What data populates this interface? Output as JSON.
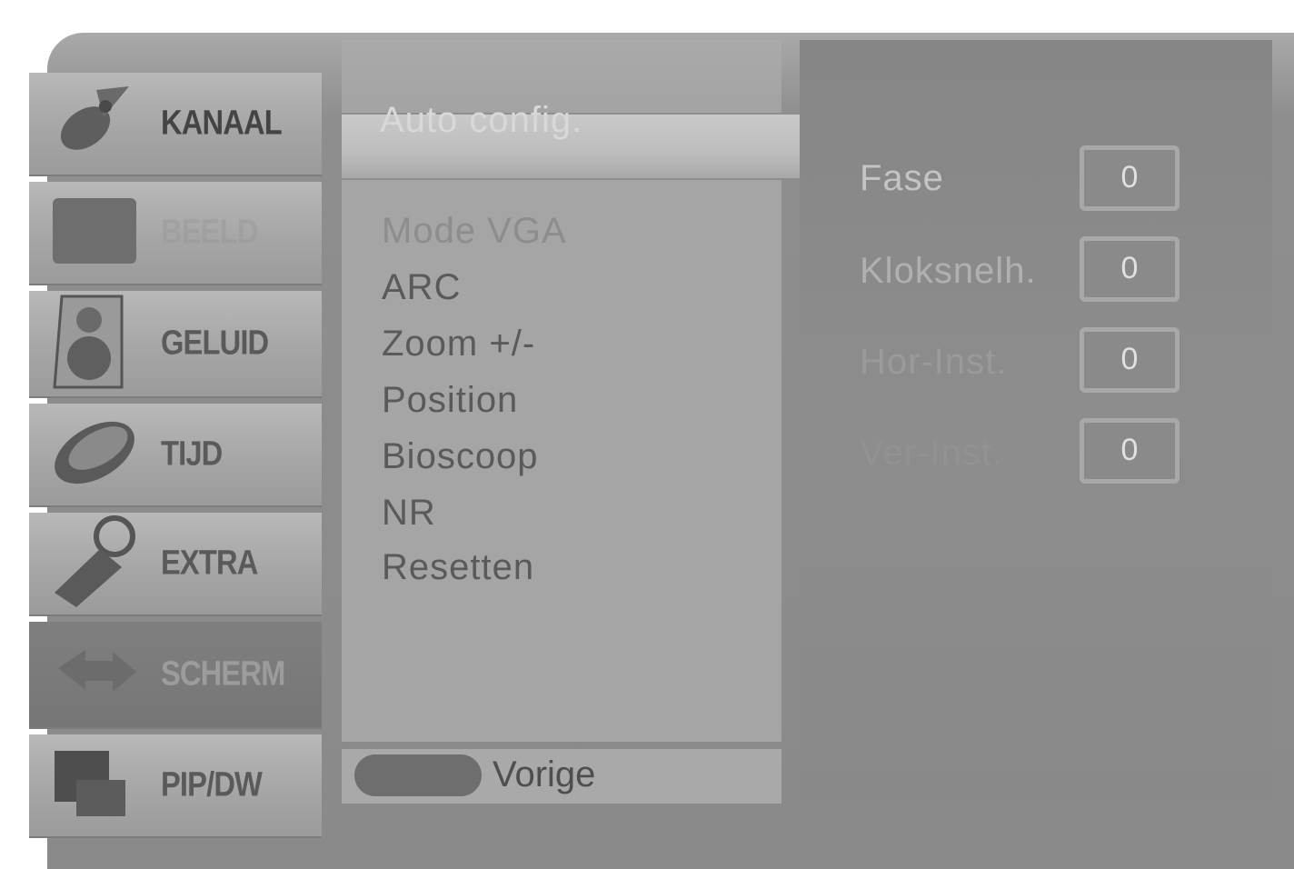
{
  "categories": [
    {
      "label": "KANAAL",
      "icon": "satellite-dish-icon"
    },
    {
      "label": "BEELD",
      "icon": "picture-icon"
    },
    {
      "label": "GELUID",
      "icon": "speaker-icon"
    },
    {
      "label": "TIJD",
      "icon": "clock-icon"
    },
    {
      "label": "EXTRA",
      "icon": "key-tag-icon"
    },
    {
      "label": "SCHERM",
      "icon": "screen-arrows-icon"
    },
    {
      "label": "PIP/DW",
      "icon": "pip-icon"
    }
  ],
  "selected_category": "SCHERM",
  "menu": {
    "items": [
      "Auto config.",
      "Mode VGA",
      "ARC",
      "Zoom +/-",
      "Position",
      "Bioscoop",
      "NR",
      "Resetten"
    ],
    "back_label": "Vorige"
  },
  "settings": [
    {
      "label": "Fase",
      "value": "0"
    },
    {
      "label": "Kloksnelh.",
      "value": "0"
    },
    {
      "label": "Hor-Inst.",
      "value": "0"
    },
    {
      "label": "Ver-Inst.",
      "value": "0"
    }
  ]
}
